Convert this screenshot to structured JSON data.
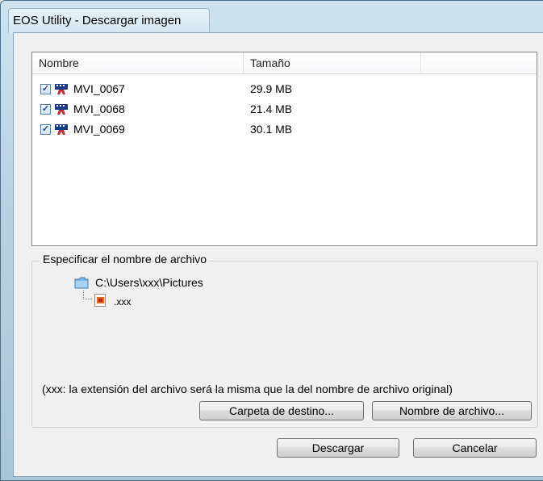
{
  "window": {
    "title": "EOS Utility - Descargar imagen"
  },
  "list": {
    "columns": [
      "Nombre",
      "Tamaño",
      ""
    ],
    "rows": [
      {
        "checked": true,
        "icon": "movie-icon",
        "name": "MVI_0067",
        "size": "29.9 MB"
      },
      {
        "checked": true,
        "icon": "movie-icon",
        "name": "MVI_0068",
        "size": "21.4 MB"
      },
      {
        "checked": true,
        "icon": "movie-icon",
        "name": "MVI_0069",
        "size": "30.1 MB"
      }
    ]
  },
  "filename_group": {
    "label": "Especificar el nombre de archivo",
    "folder_path": "C:\\Users\\xxx\\Pictures",
    "file_ext": ".xxx",
    "note": "(xxx: la extensión del archivo será la misma que la del nombre de archivo original)",
    "dest_button": "Carpeta de destino...",
    "filename_button": "Nombre de archivo..."
  },
  "actions": {
    "download": "Descargar",
    "cancel": "Cancelar"
  },
  "colors": {
    "frame": "#b9d3e3",
    "client": "#f0f0f0",
    "checkbox": "#1c4a9b",
    "movie_icon": "#1a3a8a"
  }
}
